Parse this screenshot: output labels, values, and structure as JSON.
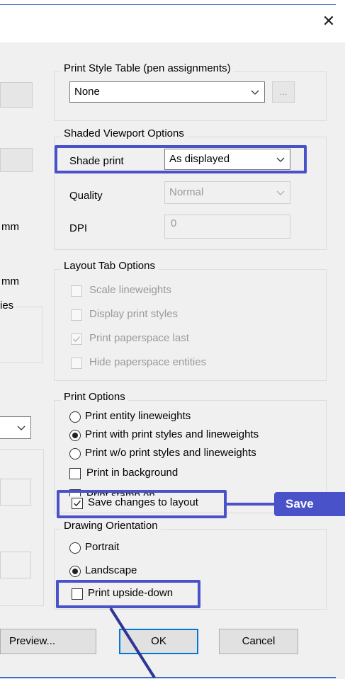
{
  "window": {
    "close_glyph": "✕"
  },
  "left_fragments": {
    "mm1": "mm",
    "mm2": "mm",
    "ies": "ies"
  },
  "print_style_table": {
    "legend": "Print Style Table (pen assignments)",
    "selected": "None",
    "edit_label": "..."
  },
  "shaded_viewport": {
    "legend": "Shaded Viewport Options",
    "shade_print_label": "Shade print",
    "shade_print_value": "As displayed",
    "quality_label": "Quality",
    "quality_value": "Normal",
    "dpi_label": "DPI",
    "dpi_value": "0"
  },
  "layout_tab": {
    "legend": "Layout Tab Options",
    "items": [
      {
        "label": "Scale lineweights",
        "checked": false
      },
      {
        "label": "Display print styles",
        "checked": false
      },
      {
        "label": "Print paperspace last",
        "checked": true
      },
      {
        "label": "Hide paperspace entities",
        "checked": false
      }
    ]
  },
  "print_options": {
    "legend": "Print Options",
    "radios": [
      {
        "label": "Print entity lineweights",
        "selected": false
      },
      {
        "label": "Print with print styles and lineweights",
        "selected": true
      },
      {
        "label": "Print w/o print styles and lineweights",
        "selected": false
      }
    ],
    "background_label": "Print in background",
    "stamp_label": "Print stamp on",
    "save_label": "Save changes to layout"
  },
  "callout": {
    "text": "Save"
  },
  "orientation": {
    "legend": "Drawing Orientation",
    "portrait_label": "Portrait",
    "landscape_label": "Landscape",
    "upside_down_label": "Print upside-down"
  },
  "buttons": {
    "preview": "Preview...",
    "ok": "OK",
    "cancel": "Cancel"
  },
  "colors": {
    "highlight": "#4a52c9",
    "focus": "#0078d7"
  }
}
